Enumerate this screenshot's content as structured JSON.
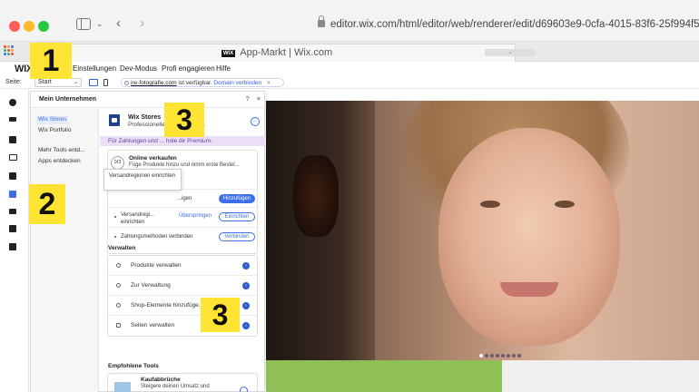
{
  "browser": {
    "url": "editor.wix.com/html/editor/web/renderer/edit/d69603e9-0cfa-4015-83f6-25f994f534b6",
    "tab_title": "App-Markt | Wix.com",
    "tab_favicon": "WIX"
  },
  "menubar": {
    "logo": "WIX",
    "items": [
      "Einstellungen",
      "Dev-Modus",
      "Profi engagieren",
      "Hilfe"
    ]
  },
  "toolbar": {
    "page_label": "Seite:",
    "page_value": "Start",
    "domain_url": "ire-fotografie.com",
    "domain_status": "ist verfügbar.",
    "domain_action": "Domain verbinden",
    "close_glyph": "×"
  },
  "panel": {
    "title": "Mein Unternehmen",
    "help": "?",
    "close": "×",
    "nav": [
      "Wix Stores",
      "Wix Portfolio",
      "Mehr Tools entd...",
      "Apps entdecken"
    ],
    "app": {
      "name": "Wix Stores",
      "subtitle": "Professionelle Plattform für ...",
      "more": "…",
      "premium_bar": "Für Zahlungen und ... hole dir Premium."
    },
    "sell": {
      "progress": "0/3",
      "title": "Online verkaufen",
      "desc": "Füge Produkte hinzu und nimm erste Bestel...",
      "tasks": [
        {
          "label": "...igen",
          "action": "Hinzufügen"
        },
        {
          "label": "Versandregi... einrichten",
          "skip": "Überspringen",
          "action": "Einrichten"
        },
        {
          "label": "Zahlungsmethoden verbinden",
          "action": "Verbinden"
        }
      ],
      "tooltip": "Versandregionen einrichten"
    },
    "manage_title": "Verwalten",
    "manage": [
      "Produkte verwalten",
      "Zur Verwaltung",
      "Shop-Elemente hinzufüge...",
      "Seiten verwalten"
    ],
    "recommended_title": "Empfohlene Tools",
    "recommended": {
      "title": "Kaufabbrüche",
      "desc": "Steigere deinen Umsatz und"
    }
  },
  "callouts": [
    "1",
    "2",
    "3",
    "3"
  ],
  "colors": {
    "accent": "#3b6ee8",
    "callout": "#ffe433",
    "premium": "#eadff5"
  }
}
